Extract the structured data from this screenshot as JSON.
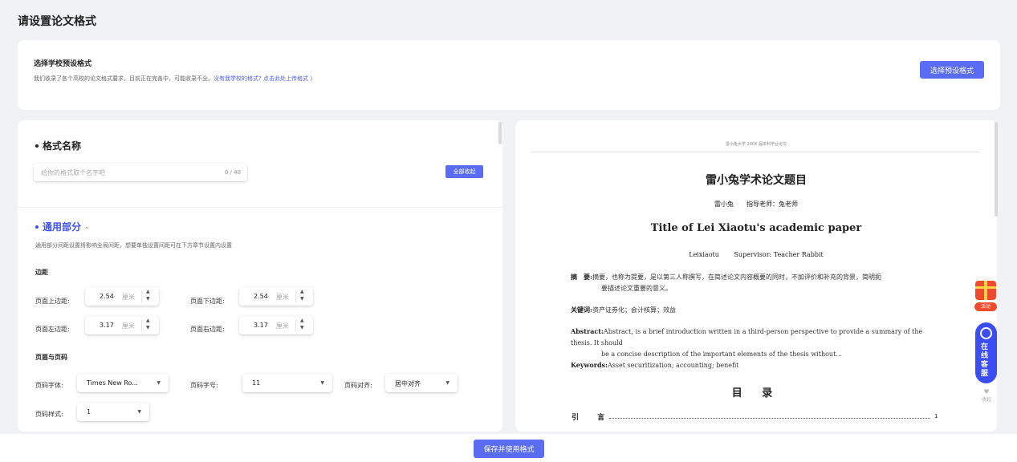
{
  "page_title": "请设置论文格式",
  "preset": {
    "title": "选择学校预设格式",
    "description": "我们收录了各个高校的论文格式要求，目前正在完善中，可能收录不全。",
    "link": "没有我学校的格式? 点击此处上传格式 〉",
    "button": "选择预设格式"
  },
  "format_name": {
    "heading": "格式名称",
    "placeholder": "给你的格式取个名字吧",
    "count": "0 / 40",
    "collapse_all": "全部收起"
  },
  "general": {
    "heading": "通用部分",
    "description": "通用部分间距设置将影响全局间距，想要单独设置间距可在下方章节设置内设置",
    "margins_heading": "边距",
    "unit": "厘米",
    "top_label": "页面上边距:",
    "top_value": "2.54",
    "bottom_label": "页面下边距:",
    "bottom_value": "2.54",
    "left_label": "页面左边距:",
    "left_value": "3.17",
    "right_label": "页面右边距:",
    "right_value": "3.17",
    "header_footer_heading": "页眉与页码",
    "page_font_label": "页码字体:",
    "page_font_value": "Times New Ro...",
    "page_size_label": "页码字号:",
    "page_size_value": "11",
    "page_align_label": "页码对齐:",
    "page_align_value": "居中对齐",
    "page_style_label": "页码样式:",
    "page_style_value": "1"
  },
  "preview": {
    "header": "雷小兔大学 200X 届本科毕业论文",
    "title_cn": "雷小兔学术论文题目",
    "authors_cn": "雷小兔　　指导老师：兔老师",
    "title_en": "Title of Lei Xiaotu's academic paper",
    "authors_en": "Leixiaotu　　 Supervisor: Teacher Rabbit",
    "abstract_cn_label": "摘　要:",
    "abstract_cn_line1": "摘要，也称为提要，是以第三人称撰写，在简述论文内容概要的同时，不加评价和补充的背景，简明扼",
    "abstract_cn_line2": "要描述论文重要的意义。",
    "keywords_cn_label": "关键词:",
    "keywords_cn": "资产证券化；会计核算；效益",
    "abstract_en_label": "Abstract:",
    "abstract_en_line1": "Abstract, is a brief introduction written in a third-person perspective to provide a summary of the thesis. It should",
    "abstract_en_line2": "be a concise description of the important elements of the thesis without...",
    "keywords_en_label": "Keywords:",
    "keywords_en": "Asset securitization; accounting; benefit",
    "toc_title": "目 录",
    "toc_entry": "引 言",
    "toc_page": "1"
  },
  "widgets": {
    "activity": "活动",
    "support": "在线客服",
    "collapse": "收起"
  },
  "save_button": "保存并使用格式",
  "colors": {
    "primary": "#5a6cf3",
    "accent_heading": "#3d52f0",
    "gift": "#f04a2e"
  }
}
